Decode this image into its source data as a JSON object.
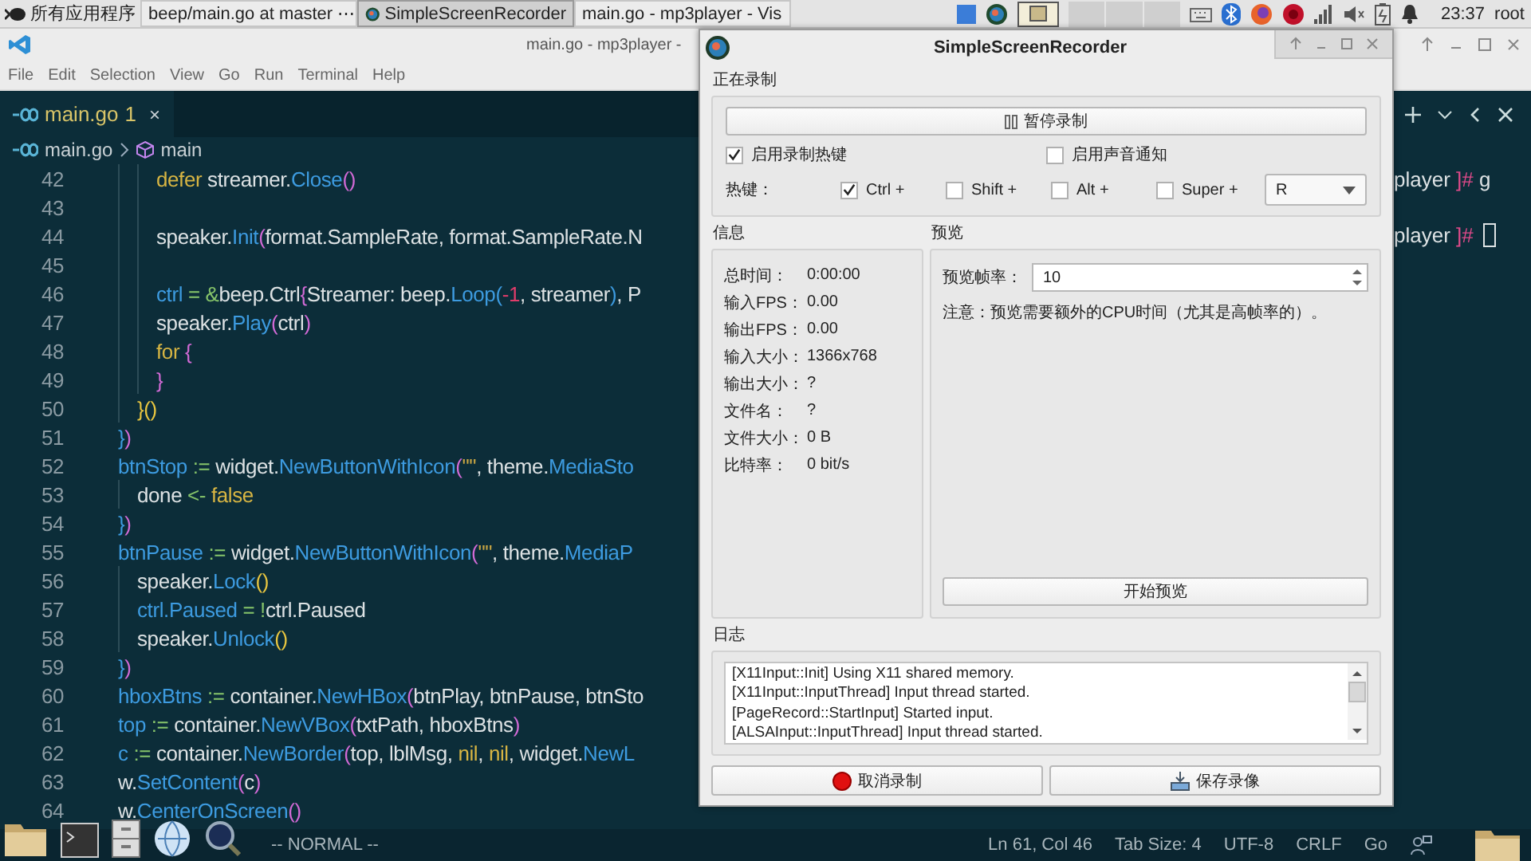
{
  "taskbar": {
    "start_label": "所有应用程序",
    "tasks": [
      {
        "label": "beep/main.go at master ⋯",
        "selected": false,
        "kind": "browser"
      },
      {
        "label": "SimpleScreenRecorder",
        "selected": true,
        "kind": "recorder"
      },
      {
        "label": "main.go - mp3player - Vis",
        "selected": false,
        "kind": "editor"
      }
    ],
    "clock": "23:37",
    "user": "root"
  },
  "editor_window": {
    "title": "main.go - mp3player -",
    "menu": [
      "File",
      "Edit",
      "Selection",
      "View",
      "Go",
      "Run",
      "Terminal",
      "Help"
    ],
    "tab": {
      "label": "main.go",
      "problems": "1",
      "close": "×"
    },
    "breadcrumb": [
      "main.go",
      "main"
    ],
    "lines": [
      {
        "children": [
          {
            "children": [
              {
                "number": "42",
                "tokens": [
                  {
                    "text": "defer",
                    "kind": "keyword"
                  },
                  {
                    "text": " streamer.",
                    "kind": "plain"
                  },
                  {
                    "text": "Close",
                    "kind": "func"
                  },
                  {
                    "text": "()",
                    "kind": "bracket2"
                  }
                ]
              },
              {
                "number": "43"
              },
              {
                "number": "44",
                "tokens": [
                  {
                    "text": "speaker.",
                    "kind": "plain"
                  },
                  {
                    "text": "Init",
                    "kind": "func"
                  },
                  {
                    "text": "(",
                    "kind": "bracket2"
                  },
                  {
                    "text": "format.SampleRate, format.SampleRate.N",
                    "kind": "plain"
                  }
                ]
              },
              {
                "number": "45"
              },
              {
                "number": "46",
                "tokens": [
                  {
                    "text": "ctrl",
                    "kind": "var"
                  },
                  {
                    "text": " = ",
                    "kind": "op"
                  },
                  {
                    "text": "&",
                    "kind": "amp"
                  },
                  {
                    "text": "beep.Ctrl",
                    "kind": "plain"
                  },
                  {
                    "text": "{",
                    "kind": "bracket2"
                  },
                  {
                    "text": "Streamer: beep.",
                    "kind": "plain"
                  },
                  {
                    "text": "Loop",
                    "kind": "func"
                  },
                  {
                    "text": "(",
                    "kind": "bracket3"
                  },
                  {
                    "text": "-1",
                    "kind": "num"
                  },
                  {
                    "text": ", streamer",
                    "kind": "plain"
                  },
                  {
                    "text": ")",
                    "kind": "bracket3"
                  },
                  {
                    "text": ", P",
                    "kind": "plain"
                  }
                ]
              },
              {
                "number": "47",
                "tokens": [
                  {
                    "text": "speaker.",
                    "kind": "plain"
                  },
                  {
                    "text": "Play",
                    "kind": "func"
                  },
                  {
                    "text": "(",
                    "kind": "bracket2"
                  },
                  {
                    "text": "ctrl",
                    "kind": "plain"
                  },
                  {
                    "text": ")",
                    "kind": "bracket2"
                  }
                ]
              },
              {
                "number": "48",
                "tokens": [
                  {
                    "text": "for",
                    "kind": "keyword"
                  },
                  {
                    "text": " {",
                    "kind": "bracket2"
                  }
                ]
              },
              {
                "number": "49",
                "tokens": [
                  {
                    "text": "}",
                    "kind": "bracket2"
                  }
                ]
              }
            ]
          },
          {
            "number": "50",
            "tokens": [
              {
                "text": "}",
                "kind": "bracket1"
              },
              {
                "text": "()",
                "kind": "bracket1"
              }
            ]
          }
        ]
      },
      {
        "number": "51",
        "tokens": [
          {
            "text": "}",
            "kind": "bracket3"
          },
          {
            "text": ")",
            "kind": "bracket2"
          }
        ]
      },
      {
        "number": "52",
        "tokens": [
          {
            "text": "btnStop",
            "kind": "var"
          },
          {
            "text": " := ",
            "kind": "op"
          },
          {
            "text": "widget.",
            "kind": "plain"
          },
          {
            "text": "NewButtonWithIcon",
            "kind": "func"
          },
          {
            "text": "(",
            "kind": "bracket2"
          },
          {
            "text": "\"\"",
            "kind": "str"
          },
          {
            "text": ", theme.",
            "kind": "plain"
          },
          {
            "text": "MediaSto",
            "kind": "var"
          }
        ],
        "children": [
          {
            "number": "53",
            "tokens": [
              {
                "text": "done",
                "kind": "plain"
              },
              {
                "text": " <- ",
                "kind": "op"
              },
              {
                "text": "false",
                "kind": "const"
              }
            ]
          }
        ]
      },
      {
        "number": "54",
        "tokens": [
          {
            "text": "}",
            "kind": "bracket3"
          },
          {
            "text": ")",
            "kind": "bracket2"
          }
        ]
      },
      {
        "number": "55",
        "tokens": [
          {
            "text": "btnPause",
            "kind": "var"
          },
          {
            "text": " := ",
            "kind": "op"
          },
          {
            "text": "widget.",
            "kind": "plain"
          },
          {
            "text": "NewButtonWithIcon",
            "kind": "func"
          },
          {
            "text": "(",
            "kind": "bracket2"
          },
          {
            "text": "\"\"",
            "kind": "str"
          },
          {
            "text": ", theme.",
            "kind": "plain"
          },
          {
            "text": "MediaP",
            "kind": "var"
          }
        ],
        "children": [
          {
            "number": "56",
            "tokens": [
              {
                "text": "speaker.",
                "kind": "plain"
              },
              {
                "text": "Lock",
                "kind": "func"
              },
              {
                "text": "()",
                "kind": "bracket1"
              }
            ]
          },
          {
            "number": "57",
            "tokens": [
              {
                "text": "ctrl.Paused",
                "kind": "var"
              },
              {
                "text": " = !",
                "kind": "op"
              },
              {
                "text": "ctrl.Paused",
                "kind": "plain"
              }
            ]
          },
          {
            "number": "58",
            "tokens": [
              {
                "text": "speaker.",
                "kind": "plain"
              },
              {
                "text": "Unlock",
                "kind": "func"
              },
              {
                "text": "()",
                "kind": "bracket1"
              }
            ]
          }
        ]
      },
      {
        "number": "59",
        "tokens": [
          {
            "text": "}",
            "kind": "bracket3"
          },
          {
            "text": ")",
            "kind": "bracket2"
          }
        ]
      },
      {
        "number": "60",
        "tokens": [
          {
            "text": "hboxBtns",
            "kind": "var"
          },
          {
            "text": " := ",
            "kind": "op"
          },
          {
            "text": "container.",
            "kind": "plain"
          },
          {
            "text": "NewHBox",
            "kind": "func"
          },
          {
            "text": "(",
            "kind": "bracket2"
          },
          {
            "text": "btnPlay, btnPause, btnSto",
            "kind": "plain"
          }
        ]
      },
      {
        "number": "61",
        "tokens": [
          {
            "text": "top",
            "kind": "var"
          },
          {
            "text": " := ",
            "kind": "op"
          },
          {
            "text": "container.",
            "kind": "plain"
          },
          {
            "text": "NewVBox",
            "kind": "func"
          },
          {
            "text": "(",
            "kind": "bracket2"
          },
          {
            "text": "txtPath, hboxBtns",
            "kind": "plain"
          },
          {
            "text": ")",
            "kind": "bracket2"
          }
        ]
      },
      {
        "number": "62",
        "tokens": [
          {
            "text": "c",
            "kind": "var"
          },
          {
            "text": " := ",
            "kind": "op"
          },
          {
            "text": "container.",
            "kind": "plain"
          },
          {
            "text": "NewBorder",
            "kind": "func"
          },
          {
            "text": "(",
            "kind": "bracket2"
          },
          {
            "text": "top, lblMsg, ",
            "kind": "plain"
          },
          {
            "text": "nil",
            "kind": "const"
          },
          {
            "text": ", ",
            "kind": "plain"
          },
          {
            "text": "nil",
            "kind": "const"
          },
          {
            "text": ", widget.",
            "kind": "plain"
          },
          {
            "text": "NewL",
            "kind": "func"
          }
        ]
      },
      {
        "number": "63",
        "tokens": [
          {
            "text": "w.",
            "kind": "plain"
          },
          {
            "text": "SetContent",
            "kind": "func"
          },
          {
            "text": "(",
            "kind": "bracket2"
          },
          {
            "text": "c",
            "kind": "plain"
          },
          {
            "text": ")",
            "kind": "bracket2"
          }
        ]
      },
      {
        "number": "64",
        "tokens": [
          {
            "text": "w.",
            "kind": "plain"
          },
          {
            "text": "CenterOnScreen",
            "kind": "func"
          },
          {
            "text": "()",
            "kind": "bracket2"
          }
        ]
      }
    ],
    "terminal_lines": [
      {
        "user": "player",
        "mark": "]#",
        "input": "g"
      },
      {
        "user": "player",
        "mark": "]#",
        "cursor": true
      }
    ],
    "status_mode": "-- NORMAL --",
    "status_right": [
      "Ln 61, Col 46",
      "Tab Size: 4",
      "UTF-8",
      "CRLF",
      "Go"
    ]
  },
  "recorder_window": {
    "title": "SimpleScreenRecorder",
    "section_recording": "正在录制",
    "pause_button": "暂停录制",
    "options": [
      {
        "label": "启用录制热键",
        "checked": true
      },
      {
        "label": "启用声音通知",
        "checked": false
      }
    ],
    "hotkey_label": "热键：",
    "modifiers": [
      {
        "label": "Ctrl +",
        "checked": true
      },
      {
        "label": "Shift +",
        "checked": false
      },
      {
        "label": "Alt +",
        "checked": false
      },
      {
        "label": "Super +",
        "checked": false
      }
    ],
    "hotkey_key": "R",
    "info_title": "信息",
    "info": [
      {
        "label": "总时间：",
        "value": "0:00:00"
      },
      {
        "label": "输入FPS：",
        "value": "0.00"
      },
      {
        "label": "输出FPS：",
        "value": "0.00"
      },
      {
        "label": "输入大小：",
        "value": "1366x768"
      },
      {
        "label": "输出大小：",
        "value": "?"
      },
      {
        "label": "文件名：",
        "value": "?"
      },
      {
        "label": "文件大小：",
        "value": "0 B"
      },
      {
        "label": "比特率：",
        "value": "0 bit/s"
      }
    ],
    "preview_title": "预览",
    "preview_rate_label": "预览帧率：",
    "preview_rate": "10",
    "preview_note": "注意：预览需要额外的CPU时间（尤其是高帧率的）。",
    "preview_button": "开始预览",
    "log_title": "日志",
    "log": [
      "[X11Input::Init] Using X11 shared memory.",
      "[X11Input::InputThread] Input thread started.",
      "[PageRecord::StartInput] Started input.",
      "[ALSAInput::InputThread] Input thread started."
    ],
    "cancel_button": "取消录制",
    "save_button": "保存录像"
  }
}
